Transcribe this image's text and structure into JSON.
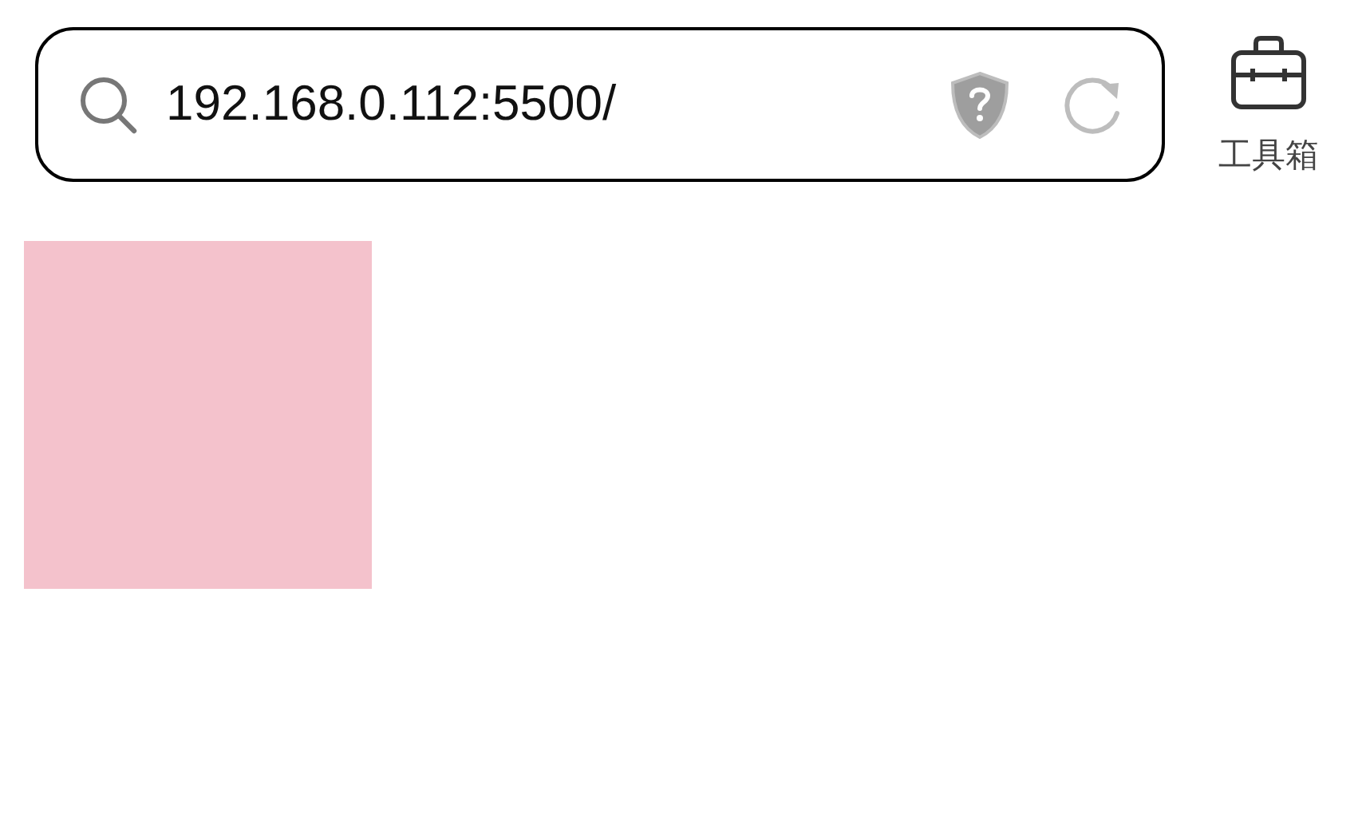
{
  "address_bar": {
    "url": "192.168.0.112:5500/"
  },
  "toolbox": {
    "label": "工具箱"
  }
}
